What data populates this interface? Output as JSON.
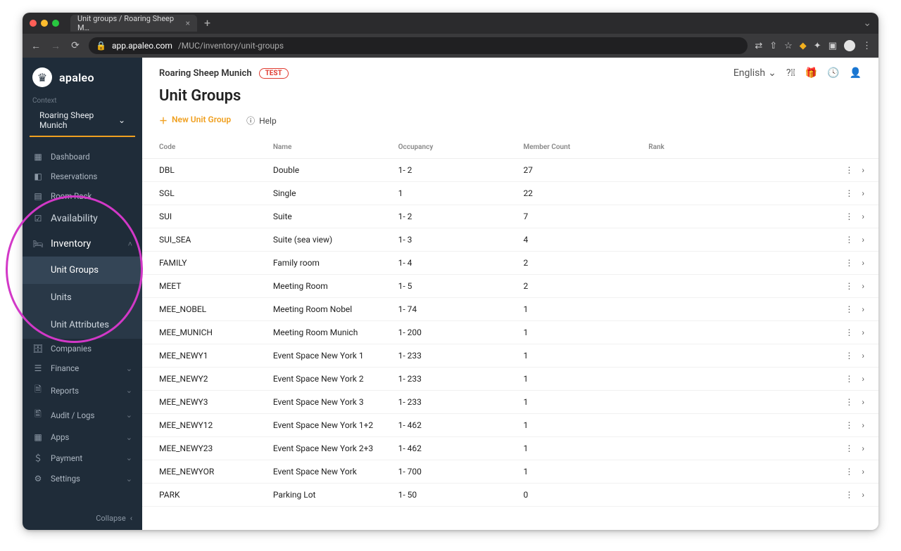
{
  "browser": {
    "tab_title": "Unit groups / Roaring Sheep M…",
    "url_host": "app.apaleo.com",
    "url_path": "/MUC/inventory/unit-groups"
  },
  "brand": {
    "name": "apaleo"
  },
  "context": {
    "label": "Context",
    "value": "Roaring Sheep Munich"
  },
  "sidebar": {
    "items": [
      {
        "label": "Dashboard"
      },
      {
        "label": "Reservations"
      },
      {
        "label": "Room Rack"
      }
    ],
    "big_items": [
      {
        "label": "Availability"
      },
      {
        "label": "Inventory"
      }
    ],
    "inventory_sub": [
      {
        "label": "Unit Groups"
      },
      {
        "label": "Units"
      },
      {
        "label": "Unit Attributes"
      }
    ],
    "items2": [
      {
        "label": "Companies"
      },
      {
        "label": "Finance"
      },
      {
        "label": "Reports"
      },
      {
        "label": "Audit / Logs"
      },
      {
        "label": "Apps"
      },
      {
        "label": "Payment"
      },
      {
        "label": "Settings"
      }
    ],
    "collapse": "Collapse"
  },
  "header": {
    "property": "Roaring Sheep Munich",
    "badge": "TEST",
    "language": "English",
    "page_title": "Unit Groups",
    "new_label": "New Unit Group",
    "help_label": "Help"
  },
  "table": {
    "headers": {
      "code": "Code",
      "name": "Name",
      "occupancy": "Occupancy",
      "member_count": "Member Count",
      "rank": "Rank"
    },
    "rows": [
      {
        "code": "DBL",
        "name": "Double",
        "occupancy": "1- 2",
        "member_count": "27",
        "rank": ""
      },
      {
        "code": "SGL",
        "name": "Single",
        "occupancy": "1",
        "member_count": "22",
        "rank": ""
      },
      {
        "code": "SUI",
        "name": "Suite",
        "occupancy": "1- 2",
        "member_count": "7",
        "rank": ""
      },
      {
        "code": "SUI_SEA",
        "name": "Suite (sea view)",
        "occupancy": "1- 3",
        "member_count": "4",
        "rank": ""
      },
      {
        "code": "FAMILY",
        "name": "Family room",
        "occupancy": "1- 4",
        "member_count": "2",
        "rank": ""
      },
      {
        "code": "MEET",
        "name": "Meeting Room",
        "occupancy": "1- 5",
        "member_count": "2",
        "rank": ""
      },
      {
        "code": "MEE_NOBEL",
        "name": "Meeting Room Nobel",
        "occupancy": "1- 74",
        "member_count": "1",
        "rank": ""
      },
      {
        "code": "MEE_MUNICH",
        "name": "Meeting Room Munich",
        "occupancy": "1- 200",
        "member_count": "1",
        "rank": ""
      },
      {
        "code": "MEE_NEWY1",
        "name": "Event Space New York 1",
        "occupancy": "1- 233",
        "member_count": "1",
        "rank": ""
      },
      {
        "code": "MEE_NEWY2",
        "name": "Event Space New York 2",
        "occupancy": "1- 233",
        "member_count": "1",
        "rank": ""
      },
      {
        "code": "MEE_NEWY3",
        "name": "Event Space New York 3",
        "occupancy": "1- 233",
        "member_count": "1",
        "rank": ""
      },
      {
        "code": "MEE_NEWY12",
        "name": "Event Space New York 1+2",
        "occupancy": "1- 462",
        "member_count": "1",
        "rank": ""
      },
      {
        "code": "MEE_NEWY23",
        "name": "Event Space New York 2+3",
        "occupancy": "1- 462",
        "member_count": "1",
        "rank": ""
      },
      {
        "code": "MEE_NEWYOR",
        "name": "Event Space New York",
        "occupancy": "1- 700",
        "member_count": "1",
        "rank": ""
      },
      {
        "code": "PARK",
        "name": "Parking Lot",
        "occupancy": "1- 50",
        "member_count": "0",
        "rank": ""
      }
    ]
  }
}
